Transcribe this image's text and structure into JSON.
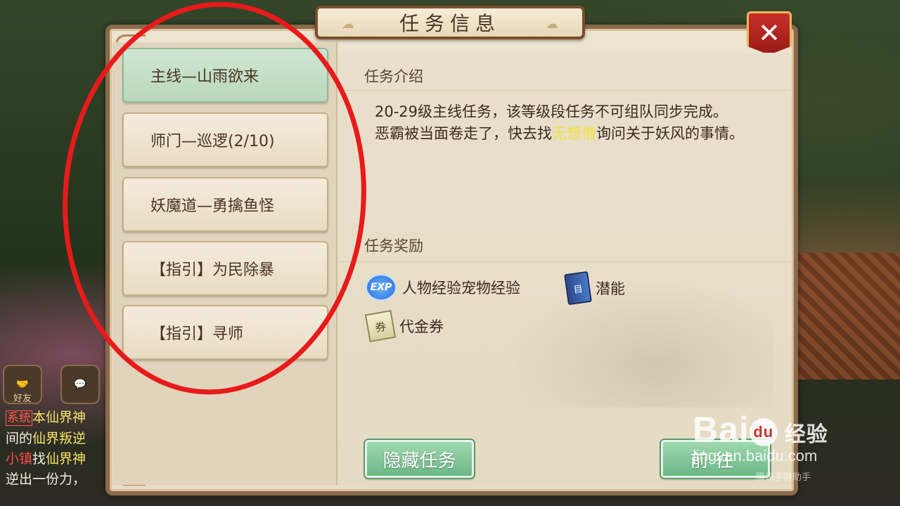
{
  "dialog": {
    "title": "任务信息",
    "close_label": "✕"
  },
  "quest_list": [
    {
      "label": "主线—山雨欲来",
      "active": true
    },
    {
      "label": "师门—巡逻(2/10)",
      "active": false
    },
    {
      "label": "妖魔道—勇擒鱼怪",
      "active": false
    },
    {
      "label": "【指引】为民除暴",
      "active": false
    },
    {
      "label": "【指引】寻师",
      "active": false
    }
  ],
  "intro": {
    "heading": "任务介绍",
    "line1": "20-29级主线任务，该等级段任务不可组队同步完成。",
    "line2_pre": "恶霸被当面卷走了，快去找",
    "line2_npc": "无想僧",
    "line2_post": "询问关于妖风的事情。",
    "npc_color": "#f2e23a"
  },
  "rewards": {
    "heading": "任务奖励",
    "items": [
      {
        "icon": "exp-icon",
        "icon_text": "EXP",
        "label": "人物经验宠物经验"
      },
      {
        "icon": "book-icon",
        "icon_text": "目",
        "label": "潜能"
      },
      {
        "icon": "coupon-icon",
        "icon_text": "券",
        "label": "代金券"
      }
    ]
  },
  "buttons": {
    "hide": "隐藏任务",
    "go": "前往"
  },
  "chat": {
    "friend_label": "好友",
    "system_tag": "系统",
    "line1_rest": "本仙界神",
    "line2_a": "间的",
    "line2_b": "仙界叛逆",
    "line3_a": "小镇",
    "line3_b": "找",
    "line3_c": "仙界神",
    "line4": "逆出一份力，"
  },
  "watermark": {
    "brand": "Bai",
    "brand_du": "du",
    "jingyan": "经验",
    "url": "jingyan.baidu.com",
    "small": "腾讯手游助手"
  },
  "colors": {
    "annotation": "#e81a1a",
    "active_item": "#c4dfc8"
  }
}
